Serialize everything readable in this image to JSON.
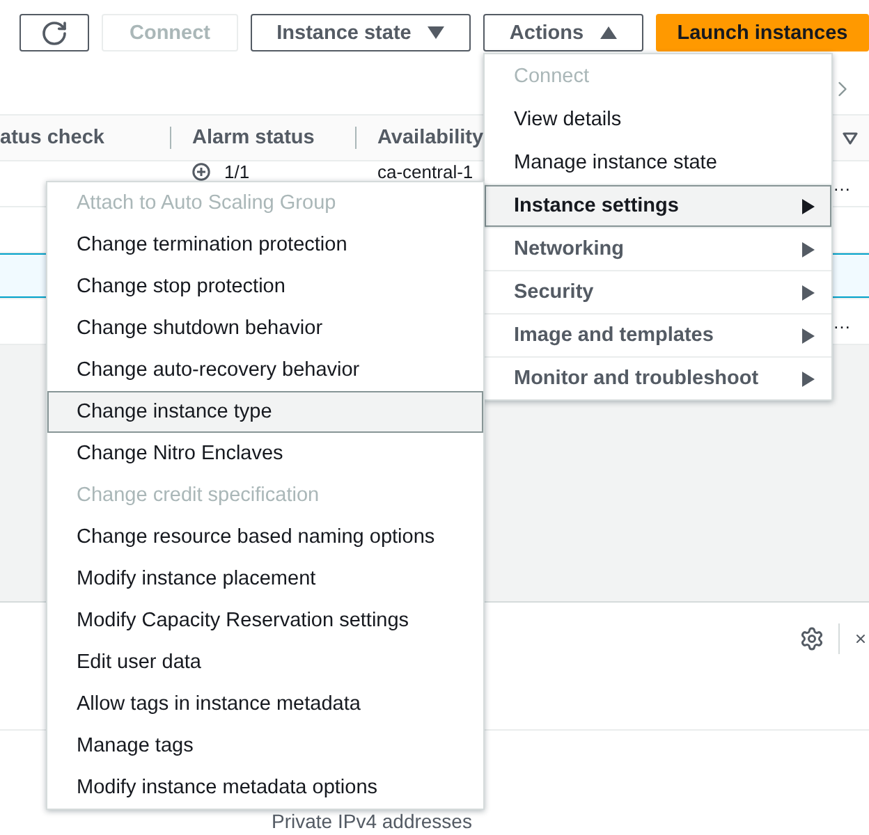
{
  "toolbar": {
    "connect_button": {
      "label": "Connect",
      "disabled": true
    },
    "instance_state_button": {
      "label": "Instance state",
      "expanded": false
    },
    "actions_button": {
      "label": "Actions",
      "expanded": true
    },
    "launch_button": {
      "label": "Launch instances"
    }
  },
  "table": {
    "columns": [
      "atus check",
      "Alarm status",
      "Availability"
    ],
    "rows": [
      {
        "selected": false,
        "alarm_status": "1/1",
        "availability": "ca-central-1",
        "column_5": "…"
      },
      {
        "selected": false
      },
      {
        "selected": true
      },
      {
        "selected": false,
        "column_5": "…"
      }
    ]
  },
  "details": {
    "label": "Private IPv4 addresses"
  },
  "actions_menu": {
    "items": [
      {
        "kind": "action",
        "label": "Connect",
        "disabled": true,
        "highlighted": false
      },
      {
        "kind": "action",
        "label": "View details",
        "disabled": false,
        "highlighted": false
      },
      {
        "kind": "action",
        "label": "Manage instance state",
        "disabled": false,
        "highlighted": false
      },
      {
        "kind": "submenu",
        "label": "Instance settings",
        "disabled": false,
        "highlighted": true
      },
      {
        "kind": "submenu",
        "label": "Networking",
        "disabled": false,
        "highlighted": false
      },
      {
        "kind": "submenu",
        "label": "Security",
        "disabled": false,
        "highlighted": false
      },
      {
        "kind": "submenu",
        "label": "Image and templates",
        "disabled": false,
        "highlighted": false
      },
      {
        "kind": "submenu",
        "label": "Monitor and troubleshoot",
        "disabled": false,
        "highlighted": false
      }
    ]
  },
  "submenu": {
    "items": [
      {
        "kind": "action",
        "label": "Attach to Auto Scaling Group",
        "disabled": true,
        "highlighted": false
      },
      {
        "kind": "action",
        "label": "Change termination protection",
        "disabled": false,
        "highlighted": false
      },
      {
        "kind": "action",
        "label": "Change stop protection",
        "disabled": false,
        "highlighted": false
      },
      {
        "kind": "action",
        "label": "Change shutdown behavior",
        "disabled": false,
        "highlighted": false
      },
      {
        "kind": "action",
        "label": "Change auto-recovery behavior",
        "disabled": false,
        "highlighted": false
      },
      {
        "kind": "action",
        "label": "Change instance type",
        "disabled": false,
        "highlighted": true
      },
      {
        "kind": "action",
        "label": "Change Nitro Enclaves",
        "disabled": false,
        "highlighted": false
      },
      {
        "kind": "action",
        "label": "Change credit specification",
        "disabled": true,
        "highlighted": false
      },
      {
        "kind": "action",
        "label": "Change resource based naming options",
        "disabled": false,
        "highlighted": false
      },
      {
        "kind": "action",
        "label": "Modify instance placement",
        "disabled": false,
        "highlighted": false
      },
      {
        "kind": "action",
        "label": "Modify Capacity Reservation settings",
        "disabled": false,
        "highlighted": false
      },
      {
        "kind": "action",
        "label": "Edit user data",
        "disabled": false,
        "highlighted": false
      },
      {
        "kind": "action",
        "label": "Allow tags in instance metadata",
        "disabled": false,
        "highlighted": false
      },
      {
        "kind": "action",
        "label": "Manage tags",
        "disabled": false,
        "highlighted": false
      },
      {
        "kind": "action",
        "label": "Modify instance metadata options",
        "disabled": false,
        "highlighted": false
      }
    ]
  }
}
